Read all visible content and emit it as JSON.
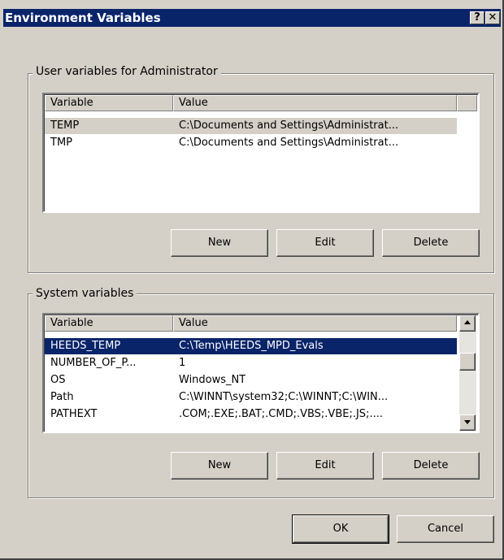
{
  "window": {
    "title": "Environment Variables",
    "help_label": "?",
    "close_label": "✕"
  },
  "user_vars": {
    "group_label": "User variables for Administrator",
    "headers": [
      "Variable",
      "Value"
    ],
    "rows": [
      {
        "variable": "TEMP",
        "value": "C:\\Documents and Settings\\Administrat..."
      },
      {
        "variable": "TMP",
        "value": "C:\\Documents and Settings\\Administrat..."
      }
    ],
    "buttons": {
      "new": "New",
      "edit": "Edit",
      "delete": "Delete"
    }
  },
  "system_vars": {
    "group_label": "System variables",
    "headers": [
      "Variable",
      "Value"
    ],
    "rows": [
      {
        "variable": "HEEDS_TEMP",
        "value": "C:\\Temp\\HEEDS_MPD_Evals"
      },
      {
        "variable": "NUMBER_OF_P...",
        "value": "1"
      },
      {
        "variable": "OS",
        "value": "Windows_NT"
      },
      {
        "variable": "Path",
        "value": "C:\\WINNT\\system32;C:\\WINNT;C:\\WIN..."
      },
      {
        "variable": "PATHEXT",
        "value": ".COM;.EXE;.BAT;.CMD;.VBS;.VBE;.JS;...."
      }
    ],
    "buttons": {
      "new": "New",
      "edit": "Edit",
      "delete": "Delete"
    }
  },
  "dialog_buttons": {
    "ok": "OK",
    "cancel": "Cancel"
  },
  "colors": {
    "title_bar": "#0a246a",
    "face": "#d4d0c8",
    "selection": "#0a246a"
  }
}
